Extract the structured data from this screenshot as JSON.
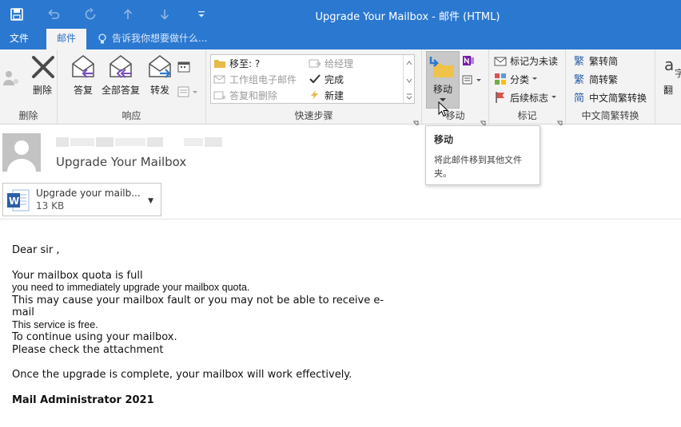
{
  "window": {
    "title": "Upgrade Your Mailbox - 邮件 (HTML)"
  },
  "quick_access": {
    "icons": [
      "save-icon",
      "undo-icon",
      "redo-icon",
      "up-icon",
      "down-icon",
      "customize-icon"
    ]
  },
  "menu": {
    "tabs": [
      {
        "label": "文件",
        "active": false
      },
      {
        "label": "邮件",
        "active": true
      }
    ],
    "tell_me": "告诉我你想要做什么..."
  },
  "ribbon": {
    "groups": {
      "delete": {
        "label": "删除",
        "buttons": {
          "delete": "删除"
        }
      },
      "respond": {
        "label": "响应",
        "buttons": {
          "reply": "答复",
          "reply_all": "全部答复",
          "forward": "转发"
        }
      },
      "quick_steps": {
        "label": "快速步骤",
        "items": {
          "move_to": "移至: ?",
          "to_manager": "给经理",
          "team_email": "工作组电子邮件",
          "done": "完成",
          "reply_delete": "答复和删除",
          "create_new": "新建"
        }
      },
      "move": {
        "label": "移动",
        "buttons": {
          "move": "移动"
        }
      },
      "tags": {
        "label": "标记",
        "buttons": {
          "mark_unread": "标记为未读",
          "categorize": "分类",
          "follow_up": "后续标志"
        }
      },
      "chinese_conversion": {
        "label": "中文简繁转换",
        "buttons": {
          "to_simplified": "繁转简",
          "to_traditional": "简转繁",
          "convert": "中文简繁转换"
        }
      },
      "translate": {
        "partial_label": "翻"
      }
    }
  },
  "tooltip": {
    "title": "移动",
    "text": "将此邮件移到其他文件夹。"
  },
  "message": {
    "subject": "Upgrade Your Mailbox",
    "attachment": {
      "name": "Upgrade your mailb...",
      "size": "13 KB"
    },
    "body": {
      "greeting": "Dear sir ,",
      "line1": "Your mailbox quota is full",
      "line2": "you need to immediately upgrade your mailbox quota.",
      "line3": "This may cause your mailbox fault or you may not be able to receive e-mail",
      "line4": "This service is free.",
      "line5": "To continue using your mailbox.",
      "line6": "Please check the attachment",
      "line7": "Once the upgrade is complete, your mailbox will work effectively.",
      "signature": "Mail Administrator 2021"
    }
  },
  "colors": {
    "title_bar": "#2b78d0",
    "ribbon_bg": "#f3f3f3",
    "active_tab_text": "#2b6fc2",
    "move_button_pressed": "#c8c8c8"
  }
}
